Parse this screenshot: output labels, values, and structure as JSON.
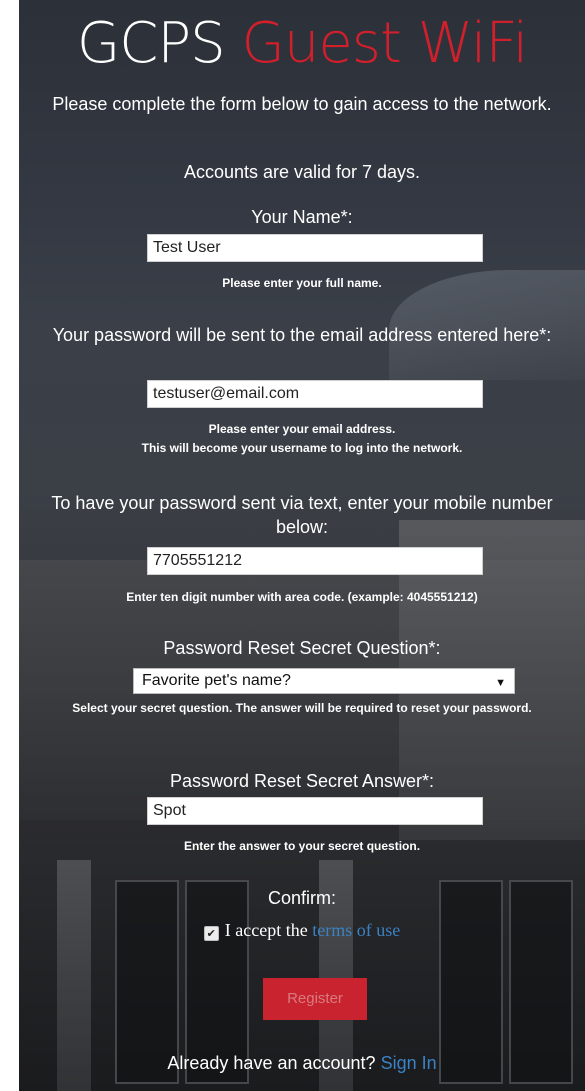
{
  "brand": {
    "part1": "GCPS",
    "part2": "Guest WiFi"
  },
  "intro": {
    "line1": "Please complete the form below to gain access to the network.",
    "line2": "Accounts are valid for 7 days."
  },
  "name_field": {
    "label": "Your Name*:",
    "value": "Test User",
    "help": "Please enter your full name."
  },
  "email_field": {
    "label": "Your password will be sent to the email address entered here*:",
    "value": "testuser@email.com",
    "help1": "Please enter your email address.",
    "help2": "This will become your username to log into the network."
  },
  "mobile_field": {
    "label": "To have your password sent via text, enter your mobile number below:",
    "value": "7705551212",
    "help": "Enter ten digit number with area code. (example: 4045551212)"
  },
  "question_field": {
    "label": "Password Reset Secret Question*:",
    "selected": "Favorite pet's name?",
    "help": "Select your secret question. The answer will be required to reset your password."
  },
  "answer_field": {
    "label": "Password Reset Secret Answer*:",
    "value": "Spot",
    "help": "Enter the answer to your secret question."
  },
  "confirm": {
    "label": "Confirm:",
    "accept_text": "I accept the",
    "terms_link": "terms of use",
    "checked": true
  },
  "register_button": "Register",
  "footer": {
    "text": "Already have an account?",
    "link": "Sign In"
  },
  "colors": {
    "brand_red": "#d11f2b",
    "link_blue": "#3a82c4",
    "button_red": "#c8232e"
  }
}
